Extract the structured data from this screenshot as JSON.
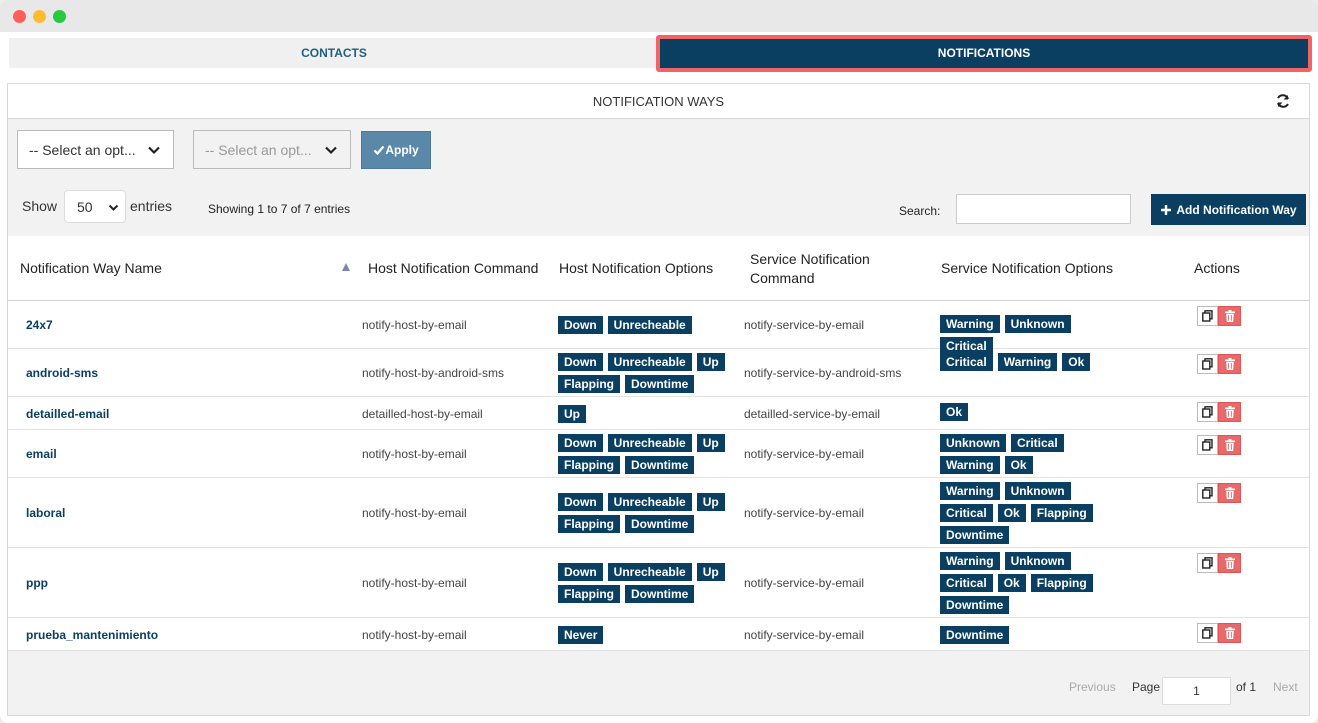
{
  "tabs": {
    "contacts": "CONTACTS",
    "notifications": "NOTIFICATIONS"
  },
  "panel": {
    "title": "NOTIFICATION WAYS"
  },
  "filters": {
    "select1_value": "-- Select an opt...",
    "select2_value": "-- Select an opt...",
    "apply_label": "Apply"
  },
  "listing": {
    "show_label": "Show",
    "page_length": "50",
    "entries_label": "entries",
    "info": "Showing 1 to 7 of 7 entries",
    "search_label": "Search:",
    "search_value": "",
    "add_label": "Add Notification Way"
  },
  "table": {
    "headers": {
      "name": "Notification Way Name",
      "host_cmd": "Host Notification Command",
      "host_opts": "Host Notification Options",
      "svc_cmd_1": "Service Notification",
      "svc_cmd_2": "Command",
      "svc_opts": "Service Notification Options",
      "actions": "Actions"
    },
    "rows": [
      {
        "name": "24x7",
        "host_cmd": "notify-host-by-email",
        "host_opts": [
          "Down",
          "Unrecheable"
        ],
        "svc_cmd": "notify-service-by-email",
        "svc_opts": [
          "Warning",
          "Unknown",
          "Critical"
        ]
      },
      {
        "name": "android-sms",
        "host_cmd": "notify-host-by-android-sms",
        "host_opts": [
          "Down",
          "Unrecheable",
          "Up",
          "Flapping",
          "Downtime"
        ],
        "svc_cmd": "notify-service-by-android-sms",
        "svc_opts": [
          "Critical",
          "Warning",
          "Ok"
        ]
      },
      {
        "name": "detailled-email",
        "host_cmd": "detailled-host-by-email",
        "host_opts": [
          "Up"
        ],
        "svc_cmd": "detailled-service-by-email",
        "svc_opts": [
          "Ok"
        ]
      },
      {
        "name": "email",
        "host_cmd": "notify-host-by-email",
        "host_opts": [
          "Down",
          "Unrecheable",
          "Up",
          "Flapping",
          "Downtime"
        ],
        "svc_cmd": "notify-service-by-email",
        "svc_opts": [
          "Unknown",
          "Critical",
          "Warning",
          "Ok"
        ]
      },
      {
        "name": "laboral",
        "host_cmd": "notify-host-by-email",
        "host_opts": [
          "Down",
          "Unrecheable",
          "Up",
          "Flapping",
          "Downtime"
        ],
        "svc_cmd": "notify-service-by-email",
        "svc_opts": [
          "Warning",
          "Unknown",
          "Critical",
          "Ok",
          "Flapping",
          "Downtime"
        ]
      },
      {
        "name": "ppp",
        "host_cmd": "notify-host-by-email",
        "host_opts": [
          "Down",
          "Unrecheable",
          "Up",
          "Flapping",
          "Downtime"
        ],
        "svc_cmd": "notify-service-by-email",
        "svc_opts": [
          "Warning",
          "Unknown",
          "Critical",
          "Ok",
          "Flapping",
          "Downtime"
        ]
      },
      {
        "name": "prueba_mantenimiento",
        "host_cmd": "notify-host-by-email",
        "host_opts": [
          "Never"
        ],
        "svc_cmd": "notify-service-by-email",
        "svc_opts": [
          "Downtime"
        ]
      }
    ]
  },
  "pagination": {
    "previous": "Previous",
    "page_label": "Page",
    "page_value": "1",
    "of_label": "of 1",
    "next": "Next"
  },
  "colors": {
    "primary": "#0a3f61",
    "danger": "#e8696a",
    "highlight": "#f06464"
  }
}
